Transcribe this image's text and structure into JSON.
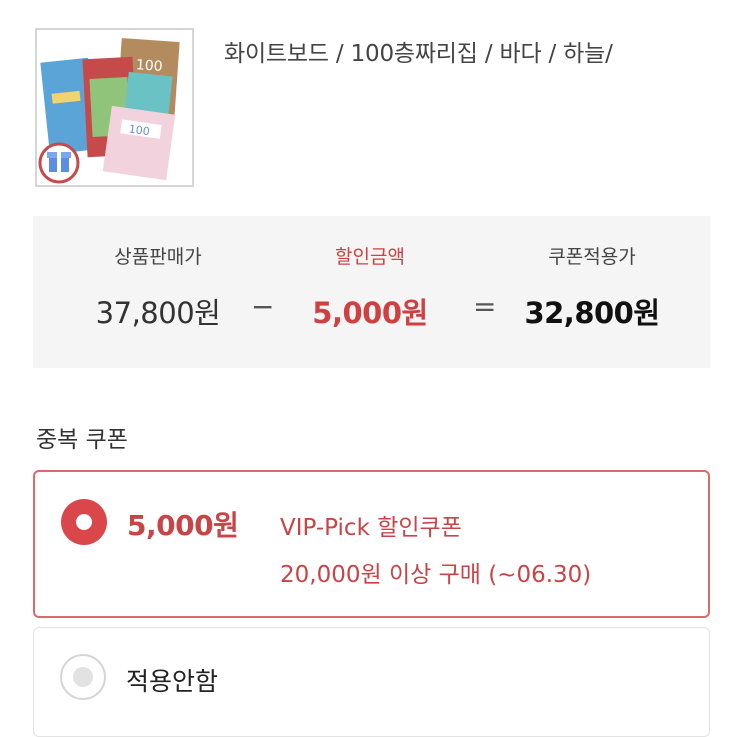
{
  "product": {
    "title": "화이트보드 / 100층짜리집 / 바다 / 하늘/",
    "thumbnail_icon": "book-bundle-thumbnail",
    "thumbnail_text": "100"
  },
  "price_summary": {
    "sale_price_label": "상품판매가",
    "sale_price_value": "37,800원",
    "minus": "−",
    "discount_label": "할인금액",
    "discount_value": "5,000원",
    "equals": "=",
    "final_label": "쿠폰적용가",
    "final_value": "32,800원"
  },
  "coupons": {
    "section_title": "중복 쿠폰",
    "options": [
      {
        "selected": true,
        "amount": "5,000원",
        "name": "VIP-Pick 할인쿠폰",
        "condition": "20,000원 이상 구매 (~06.30)"
      },
      {
        "selected": false,
        "label": "적용안함"
      }
    ]
  },
  "colors": {
    "accent": "#d9474a",
    "discount_text": "#d04040",
    "summary_bg": "#f5f5f5"
  }
}
